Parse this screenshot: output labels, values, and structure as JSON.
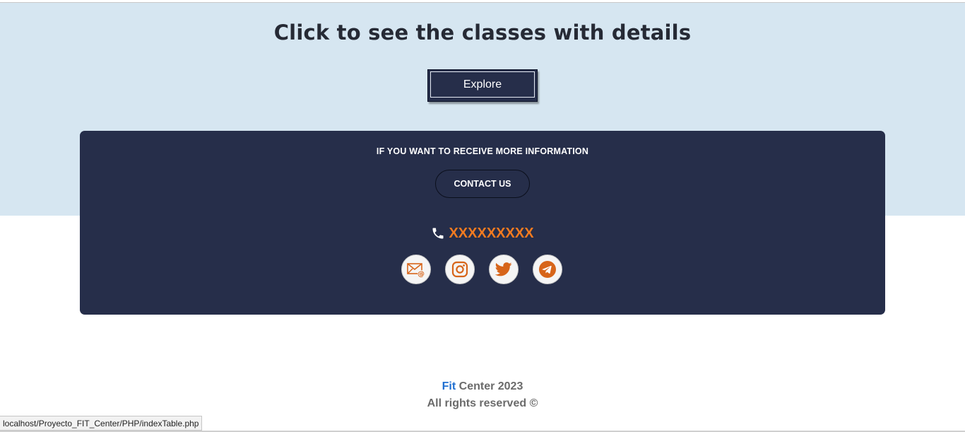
{
  "hero": {
    "title": "Click to see the classes with details",
    "explore_label": "Explore"
  },
  "info_card": {
    "heading": "IF YOU WANT TO RECEIVE MORE INFORMATION",
    "contact_label": "CONTACT US",
    "phone_icon": "phone-icon",
    "phone_number": "XXXXXXXXX",
    "social_icons": [
      "email-icon",
      "instagram-icon",
      "twitter-icon",
      "telegram-icon"
    ]
  },
  "footer": {
    "brand": "Fit",
    "line1_rest": " Center 2023",
    "line2": "All rights reserved ©"
  },
  "status_bar": {
    "url": "localhost/Proyecto_FIT_Center/PHP/indexTable.php"
  },
  "colors": {
    "hero_bg": "#d6e6f1",
    "card_bg": "#262e4a",
    "accent_orange": "#f47b20",
    "brand_blue": "#1f6fd1"
  }
}
